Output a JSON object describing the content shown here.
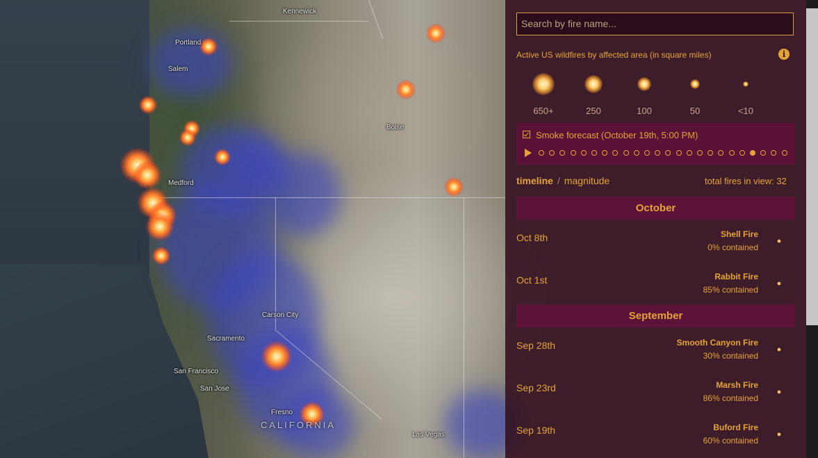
{
  "map": {
    "cities": [
      "Kennewick",
      "Portland",
      "Salem",
      "Boise",
      "Medford",
      "Carson City",
      "Sacramento",
      "San Francisco",
      "San Jose",
      "Fresno",
      "Las Vegas"
    ],
    "state_label": "CALIFORNIA"
  },
  "panel": {
    "search_placeholder": "Search by fire name...",
    "legend_title": "Active US wildfires by affected area (in square miles)",
    "legend_sizes": [
      "650+",
      "250",
      "100",
      "50",
      "<10"
    ],
    "smoke_label": "Smoke forecast  (October 19th, 5:00 PM)",
    "smoke_checked": true,
    "timeline_total_steps": 24,
    "timeline_active_step": 20,
    "tab_timeline": "timeline",
    "tab_separator": "/",
    "tab_magnitude": "magnitude",
    "total_fires": "total fires in view: 32",
    "months": [
      {
        "label": "October",
        "fires": [
          {
            "date": "Oct 8th",
            "name": "Shell Fire",
            "contained": "0% contained"
          },
          {
            "date": "Oct 1st",
            "name": "Rabbit Fire",
            "contained": "85% contained"
          }
        ]
      },
      {
        "label": "September",
        "fires": [
          {
            "date": "Sep 28th",
            "name": "Smooth Canyon Fire",
            "contained": "30% contained"
          },
          {
            "date": "Sep 23rd",
            "name": "Marsh Fire",
            "contained": "86% contained"
          },
          {
            "date": "Sep 19th",
            "name": "Buford Fire",
            "contained": "60% contained"
          }
        ]
      }
    ]
  },
  "colors": {
    "accent": "#e6a434",
    "panel_bg": "#341220",
    "month_bg": "#5d1238",
    "smoke": "#3c46be"
  }
}
